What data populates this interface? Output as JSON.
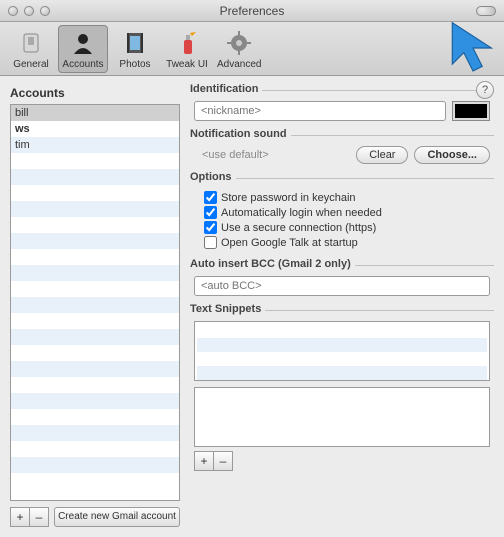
{
  "window": {
    "title": "Preferences"
  },
  "toolbar": {
    "items": [
      {
        "label": "General"
      },
      {
        "label": "Accounts"
      },
      {
        "label": "Photos"
      },
      {
        "label": "Tweak UI"
      },
      {
        "label": "Advanced"
      }
    ]
  },
  "accounts": {
    "heading": "Accounts",
    "list": [
      "bill",
      "ws",
      "tim"
    ],
    "add": "+",
    "remove": "–",
    "create": "Create new Gmail account"
  },
  "identification": {
    "heading": "Identification",
    "nickname_placeholder": "<nickname>",
    "help": "?",
    "color": "#000000"
  },
  "notification": {
    "heading": "Notification sound",
    "default_text": "<use default>",
    "clear": "Clear",
    "choose": "Choose..."
  },
  "options": {
    "heading": "Options",
    "items": [
      {
        "label": "Store password in keychain",
        "checked": true
      },
      {
        "label": "Automatically login when needed",
        "checked": true
      },
      {
        "label": "Use a secure connection (https)",
        "checked": true
      },
      {
        "label": "Open Google Talk at startup",
        "checked": false
      }
    ]
  },
  "bcc": {
    "heading": "Auto insert BCC (Gmail 2 only)",
    "placeholder": "<auto BCC>"
  },
  "snippets": {
    "heading": "Text Snippets",
    "add": "+",
    "remove": "–"
  }
}
